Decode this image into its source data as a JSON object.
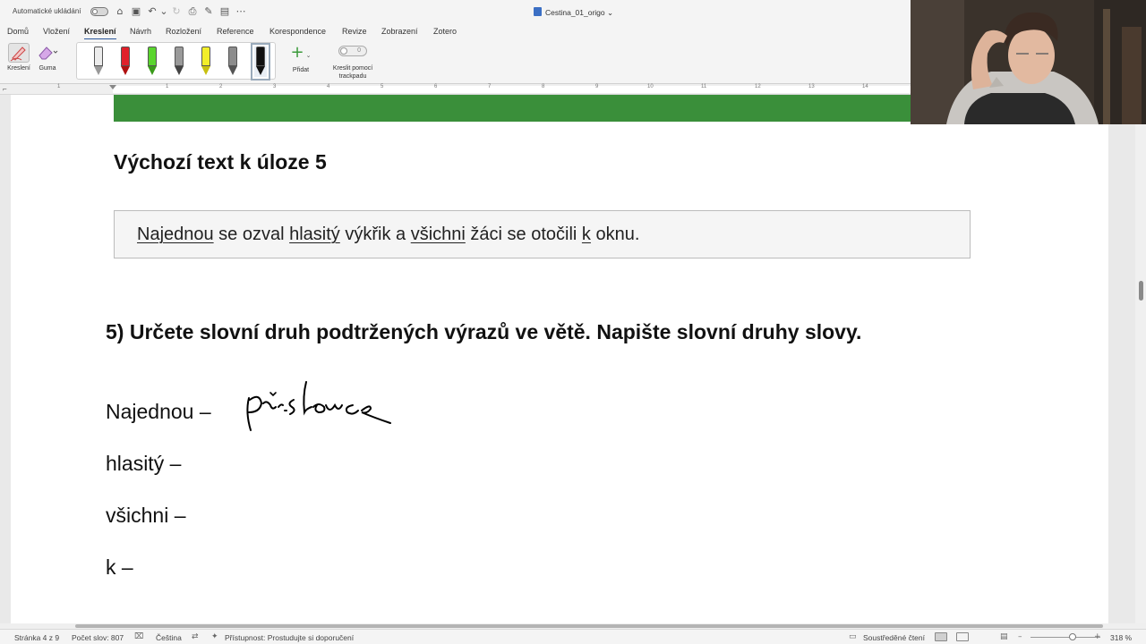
{
  "titlebar": {
    "autosave_label": "Automatické ukládání",
    "document_title": "Cestina_01_origo",
    "icons": [
      "home-icon",
      "save-icon",
      "undo-icon",
      "redo-icon",
      "print-icon",
      "pen-icon",
      "layout-icon",
      "more-icon"
    ]
  },
  "tabs": [
    "Domů",
    "Vložení",
    "Kreslení",
    "Návrh",
    "Rozložení",
    "Reference",
    "Korespondence",
    "Revize",
    "Zobrazení",
    "Zotero"
  ],
  "active_tab": "Kreslení",
  "ribbon": {
    "draw_label": "Kreslení",
    "eraser_label": "Guma",
    "add_label": "Přidat",
    "trackpad_label_1": "Kreslit pomocí",
    "trackpad_label_2": "trackpadu",
    "trackpad_toggle_value": "0",
    "pens": [
      {
        "name": "pencil-gray",
        "color": "#e8e8e8"
      },
      {
        "name": "pen-red",
        "color": "#e0202a"
      },
      {
        "name": "pen-green",
        "color": "#5ad52e"
      },
      {
        "name": "pencil-dark",
        "color": "#9a9a9a"
      },
      {
        "name": "highlighter-yellow",
        "color": "#f2ee2a"
      },
      {
        "name": "pen-gray",
        "color": "#8c8c8c"
      },
      {
        "name": "pen-black",
        "color": "#111111"
      }
    ]
  },
  "ruler": {
    "numbers": [
      "1",
      "1",
      "2",
      "3",
      "4",
      "5",
      "6",
      "7",
      "8",
      "9",
      "10",
      "11",
      "12",
      "13",
      "14"
    ]
  },
  "document": {
    "heading": "Výchozí text k úloze 5",
    "sentence": {
      "w1": "Najednou",
      "t1": " se ozval ",
      "w2": "hlasitý",
      "t2": " výkřik a ",
      "w3": "všichni",
      "t3": " žáci se otočili ",
      "w4": "k",
      "t4": " oknu."
    },
    "question": "5)  Určete slovní druh podtržených výrazů ve větě. Napište slovní druhy slovy.",
    "answers": [
      "Najednou –",
      "hlasitý –",
      "všichni –",
      "k –"
    ],
    "handwritten_answer": "příslovce"
  },
  "statusbar": {
    "page": "Stránka 4 z 9",
    "words": "Počet slov: 807",
    "language": "Čeština",
    "accessibility": "Přístupnost: Prostudujte si doporučení",
    "focus": "Soustředěné čtení",
    "zoom": "318 %"
  }
}
